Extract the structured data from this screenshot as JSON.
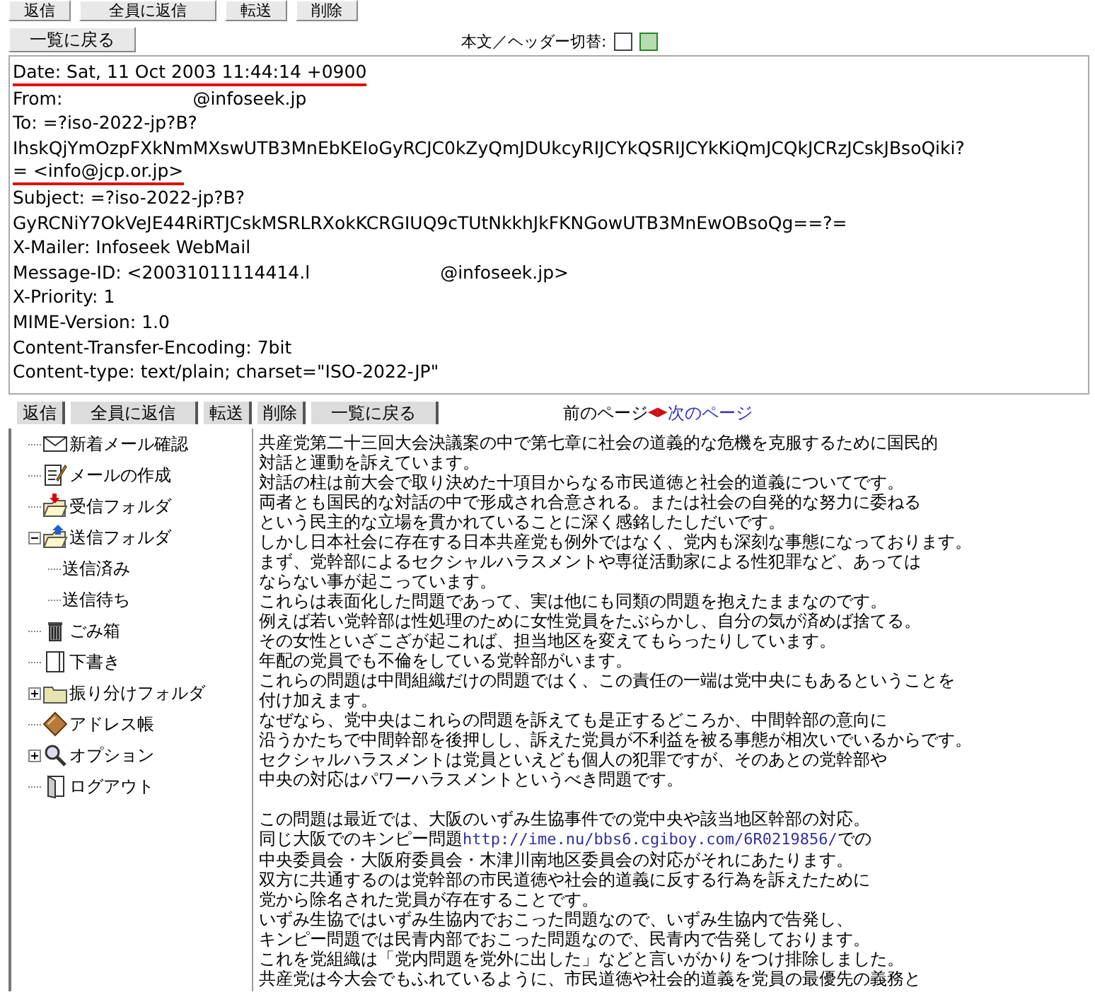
{
  "top_buttons": [
    "返信",
    "全員に返信",
    "転送",
    "削除"
  ],
  "back_button": "一覧に戻る",
  "view_toggle": {
    "label": "本文／ヘッダー切替:",
    "modes": [
      {
        "kind": "body",
        "selected": false
      },
      {
        "kind": "header",
        "selected": true
      }
    ]
  },
  "headers": [
    {
      "text": "Date: Sat, 11 Oct 2003 11:44:14 +0900",
      "underlined": true
    },
    {
      "text": "From:",
      "text_after": "@infoseek.jp",
      "underlined": false
    },
    {
      "text": "To: =?iso-2022-jp?B?",
      "underlined": false
    },
    {
      "text": "IhskQjYmOzpFXkNmMXswUTB3MnEbKEIoGyRCJC0kZyQmJDUkcyRIJCYkQSRIJCYkKiQmJCQkJCRzJCskJBsoQiki?",
      "underlined": false
    },
    {
      "text": "= <info@jcp.or.jp>",
      "underlined": true
    },
    {
      "text": "Subject: =?iso-2022-jp?B?",
      "underlined": false
    },
    {
      "text": "GyRCNiY7OkVeJE44RiRTJCskMSRLRXokKCRGIUQ9cTUtNkkhJkFKNGowUTB3MnEwOBsoQg==?=",
      "underlined": false
    },
    {
      "text": "X-Mailer: Infoseek WebMail",
      "underlined": false
    },
    {
      "text": "Message-ID: <20031011114414.l",
      "text_after": "@infoseek.jp>",
      "underlined": false
    },
    {
      "text": "X-Priority: 1",
      "underlined": false
    },
    {
      "text": "MIME-Version: 1.0",
      "underlined": false
    },
    {
      "text": "Content-Transfer-Encoding: 7bit",
      "underlined": false
    },
    {
      "text": "Content-type: text/plain; charset=\"ISO-2022-JP\"",
      "underlined": false
    }
  ],
  "action_buttons": [
    "返信",
    "全員に返信",
    "転送",
    "削除",
    "一覧に戻る"
  ],
  "pager": {
    "previous": "前のページ",
    "prev_arrow": "◀",
    "next_arrow": "▶",
    "next": "次のページ"
  },
  "sidebar": {
    "items": [
      {
        "kind": "envelope",
        "label": "新着メール確認"
      },
      {
        "kind": "compose",
        "label": "メールの作成"
      },
      {
        "kind": "inbox",
        "label": "受信フォルダ"
      },
      {
        "kind": "outbox",
        "label": "送信フォルダ",
        "expanded": true,
        "children": [
          {
            "label": "送信済み"
          },
          {
            "label": "送信待ち"
          }
        ]
      },
      {
        "kind": "trash",
        "label": "ごみ箱"
      },
      {
        "kind": "draft",
        "label": "下書き"
      },
      {
        "kind": "folder",
        "label": "振り分けフォルダ",
        "expanded": false
      },
      {
        "kind": "addressbook",
        "label": "アドレス帳"
      },
      {
        "kind": "options",
        "label": "オプション",
        "expanded": false
      },
      {
        "kind": "logout",
        "label": "ログアウト"
      }
    ]
  },
  "message_paragraphs": [
    [
      {
        "text": "共産党第二十三回大会決議案の中で第七章に社会の道義的な危機を克服するために国民的"
      },
      {
        "text": "対話と運動を訴えています。"
      },
      {
        "text": "対話の柱は前大会で取り決めた十項目からなる市民道徳と社会的道義についてです。"
      },
      {
        "text": "両者とも国民的な対話の中で形成され合意される。または社会の自発的な努力に委ねる"
      },
      {
        "text": "という民主的な立場を貫かれていることに深く感銘したしだいです。"
      },
      {
        "text": "しかし日本社会に存在する日本共産党も例外ではなく、党内も深刻な事態になっております。"
      },
      {
        "text": "まず、党幹部によるセクシャルハラスメントや専従活動家による性犯罪など、あっては"
      },
      {
        "text": "ならない事が起こっています。"
      },
      {
        "text": "これらは表面化した問題であって、実は他にも同類の問題を抱えたままなのです。"
      },
      {
        "text": "例えば若い党幹部は性処理のために女性党員をたぶらかし、自分の気が済めば捨てる。"
      },
      {
        "text": "その女性といざこざが起これば、担当地区を変えてもらったりしています。"
      },
      {
        "text": "年配の党員でも不倫をしている党幹部がいます。"
      },
      {
        "text": "これらの問題は中間組織だけの問題ではく、この責任の一端は党中央にもあるということを"
      },
      {
        "text": "付け加えます。"
      },
      {
        "text": "なぜなら、党中央はこれらの問題を訴えても是正するどころか、中間幹部の意向に"
      },
      {
        "text": "沿うかたちで中間幹部を後押しし、訴えた党員が不利益を被る事態が相次いでいるからです。"
      },
      {
        "text": "セクシャルハラスメントは党員といえども個人の犯罪ですが、そのあとの党幹部や"
      },
      {
        "text": "中央の対応はパワーハラスメントというべき問題です。"
      }
    ],
    [
      {
        "text": "この問題は最近では、大阪のいずみ生協事件での党中央や該当地区幹部の対応。"
      },
      {
        "text": "同じ大阪でのキンピー問題",
        "link": "http://ime.nu/bbs6.cgiboy.com/6R0219856/",
        "text_after": "での"
      },
      {
        "text": "中央委員会・大阪府委員会・木津川南地区委員会の対応がそれにあたります。"
      },
      {
        "text": "双方に共通するのは党幹部の市民道徳や社会的道義に反する行為を訴えたために"
      },
      {
        "text": "党から除名された党員が存在することです。"
      },
      {
        "text": "いずみ生協ではいずみ生協内でおこった問題なので、いずみ生協内で告発し、"
      },
      {
        "text": "キンピー問題では民青内部でおこった問題なので、民青内で告発しております。"
      },
      {
        "text": "これを党組織は「党内問題を党外に出した」などと言いがかりをつけ排除しました。"
      },
      {
        "text": "共産党は今大会でもふれているように、市民道徳や社会的道義を党員の最優先の義務と"
      }
    ]
  ]
}
